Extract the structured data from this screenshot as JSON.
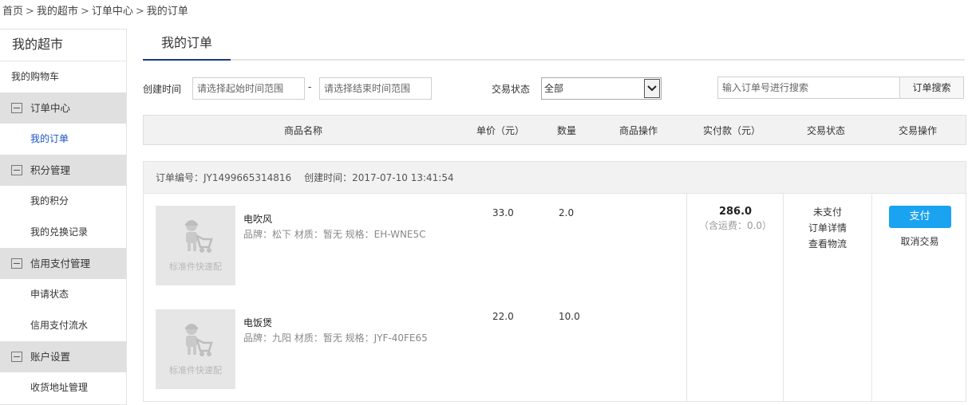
{
  "breadcrumb": {
    "items": [
      "首页",
      "我的超市",
      "订单中心",
      "我的订单"
    ],
    "separator": ">"
  },
  "sidebar": {
    "title": "我的超市",
    "cart_link": "我的购物车",
    "groups": [
      {
        "label": "订单中心",
        "items": [
          "我的订单"
        ]
      },
      {
        "label": "积分管理",
        "items": [
          "我的积分",
          "我的兑换记录"
        ]
      },
      {
        "label": "信用支付管理",
        "items": [
          "申请状态",
          "信用支付流水"
        ]
      },
      {
        "label": "账户设置",
        "items": [
          "收货地址管理"
        ]
      }
    ]
  },
  "tab": {
    "active_label": "我的订单"
  },
  "filter": {
    "created_label": "创建时间",
    "start_placeholder": "请选择起始时间范围",
    "end_placeholder": "请选择结束时间范围",
    "dash": "-",
    "status_label": "交易状态",
    "status_selected": "全部",
    "search_placeholder": "输入订单号进行搜索",
    "search_button": "订单搜索"
  },
  "table": {
    "headers": [
      "商品名称",
      "单价（元）",
      "数量",
      "商品操作",
      "实付款（元）",
      "交易状态",
      "交易操作"
    ]
  },
  "order": {
    "number_label": "订单编号：",
    "number": "JY1499665314816",
    "created_label": "创建时间：",
    "created": "2017-07-10 13:41:54",
    "placeholder_text": "标准件快速配",
    "items": [
      {
        "name": "电吹风",
        "spec": "品牌：松下 材质：暂无 规格：EH-WNE5C",
        "price": "33.0",
        "qty": "2.0"
      },
      {
        "name": "电饭煲",
        "spec": "品牌：九阳 材质：暂无 规格：JYF-40FE65",
        "price": "22.0",
        "qty": "10.0"
      }
    ],
    "paid_amount": "286.0",
    "shipping_note": "（含运费：0.0）",
    "status": [
      "未支付",
      "订单详情",
      "查看物流"
    ],
    "pay_button": "支付",
    "cancel_link": "取消交易"
  },
  "colors": {
    "accent": "#1aa3f0",
    "active_link": "#1b56c1",
    "group_bg": "#e0e0e0"
  }
}
